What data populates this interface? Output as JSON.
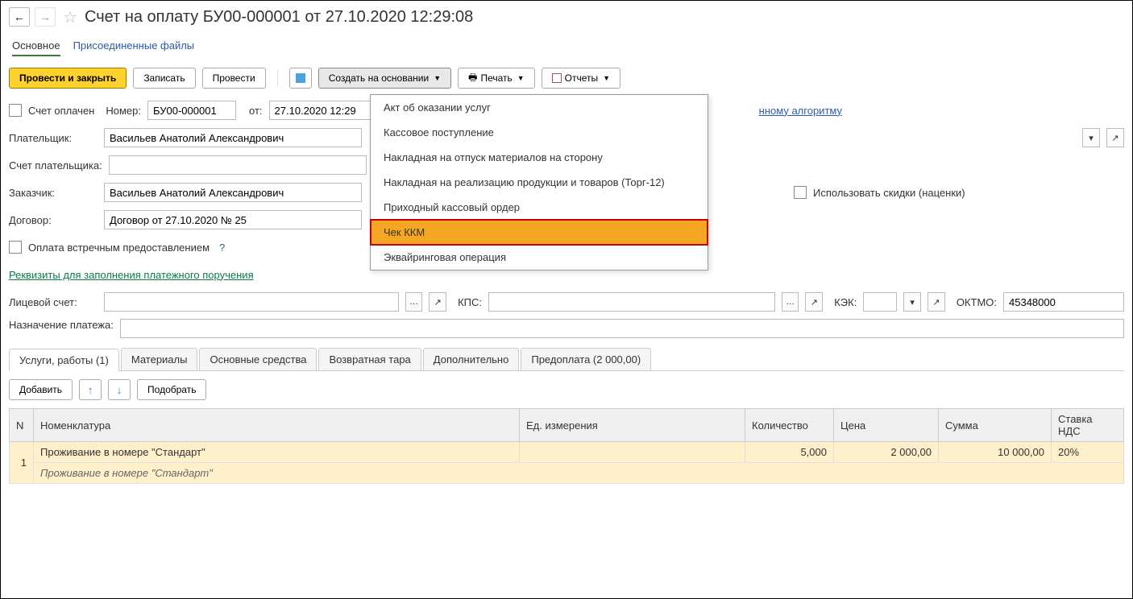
{
  "header": {
    "title": "Счет на оплату БУ00-000001 от 27.10.2020 12:29:08"
  },
  "page_tabs": {
    "main": "Основное",
    "files": "Присоединенные файлы"
  },
  "toolbar": {
    "post_close": "Провести и закрыть",
    "write": "Записать",
    "post": "Провести",
    "create_on_basis": "Создать на основании",
    "print": "Печать",
    "reports": "Отчеты"
  },
  "create_menu": [
    "Акт об оказании услуг",
    "Кассовое поступление",
    "Накладная на отпуск материалов на сторону",
    "Накладная на реализацию продукции и товаров (Торг-12)",
    "Приходный кассовый ордер",
    "Чек ККМ",
    "Эквайринговая операция"
  ],
  "form": {
    "paid_label": "Счет оплачен",
    "number_label": "Номер:",
    "number": "БУ00-000001",
    "from_label": "от:",
    "date": "27.10.2020 12:29",
    "link_algo": "нному алгоритму",
    "payer_label": "Плательщик:",
    "payer": "Васильев Анатолий Александрович",
    "payer_account_label": "Счет плательщика:",
    "payer_account": "",
    "customer_label": "Заказчик:",
    "customer": "Васильев Анатолий Александрович",
    "discounts_label": "Использовать скидки (наценки)",
    "contract_label": "Договор:",
    "contract": "Договор от 27.10.2020 № 25",
    "counter_payment_label": "Оплата встречным предоставлением",
    "payment_details_link": "Реквизиты для заполнения платежного поручения",
    "account_label": "Лицевой счет:",
    "kps_label": "КПС:",
    "kek_label": "КЭК:",
    "oktmo_label": "ОКТМО:",
    "oktmo": "45348000",
    "purpose_label": "Назначение платежа:"
  },
  "tabs": {
    "services": "Услуги, работы (1)",
    "materials": "Материалы",
    "assets": "Основные средства",
    "packaging": "Возвратная тара",
    "extra": "Дополнительно",
    "prepay": "Предоплата (2 000,00)"
  },
  "table_bar": {
    "add": "Добавить",
    "pick": "Подобрать"
  },
  "columns": {
    "n": "N",
    "nomen": "Номенклатура",
    "unit": "Ед. измерения",
    "qty": "Количество",
    "price": "Цена",
    "sum": "Сумма",
    "vat": "Ставка НДС"
  },
  "rows": [
    {
      "n": "1",
      "nomen": "Проживание в номере \"Стандарт\"",
      "desc": "Проживание в номере \"Стандарт\"",
      "unit": "",
      "qty": "5,000",
      "price": "2 000,00",
      "sum": "10 000,00",
      "vat": "20%"
    }
  ]
}
